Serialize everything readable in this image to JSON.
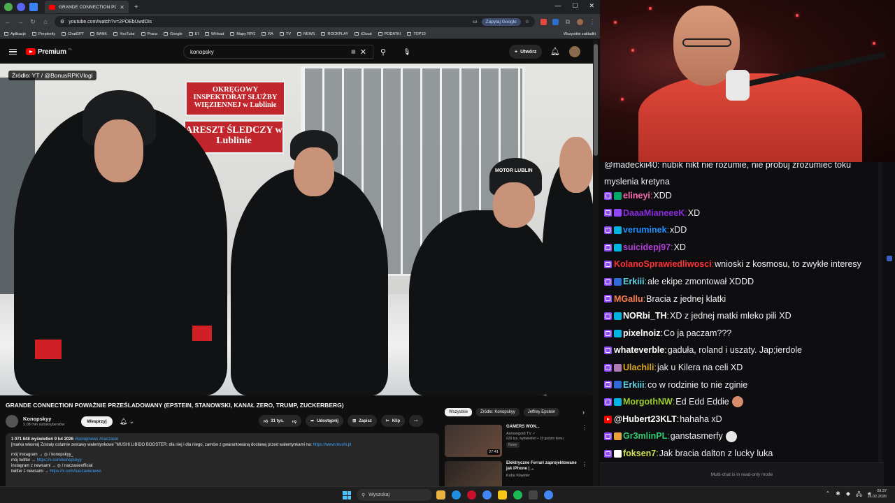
{
  "browser": {
    "tab_title": "GRANDE CONNECTION POWA",
    "url": "youtube.com/watch?v=2POEbUwdOis",
    "ask_google": "Zapytaj Google",
    "bookmarks": [
      "Aplikacje",
      "Perplexity",
      "ChatGPT",
      "BANK",
      "YouTube",
      "Praca",
      "Google",
      "EI",
      "WHead",
      "Mapy RPG",
      "RA",
      "TV",
      "NEWS",
      "ROCKPLAY",
      "iCloud",
      "PODATKI",
      "TOP10"
    ],
    "all_bookmarks": "Wszystkie zakładki"
  },
  "youtube": {
    "logo_text": "Premium",
    "logo_region": "PL",
    "search_value": "konopsky",
    "create_label": "Utwórz",
    "video_source_badge": "Źródło: YT / @BonusRPKVlogi",
    "sign1": "OKRĘGOWY INSPEKTORAT SŁUŻBY WIĘZIENNEJ w Lublinie",
    "sign2": "ARESZT ŚLEDCZY w Lublinie",
    "hat_text": "MOTOR LUBLIN",
    "video_title": "GRANDE CONNECTION POWAŻNIE PRZEŚLADOWANY (EPSTEIN, STANOWSKI, KANAŁ ZERO, TRUMP, ZUCKERBERG)",
    "channel_name": "Konopskyy",
    "channel_subs": "2,08 mln subskrybentów",
    "support_label": "Wesprzyj",
    "likes": "31 tys.",
    "share_label": "Udostępnij",
    "save_label": "Zapisz",
    "clip_label": "Klip",
    "desc_meta": "1 071 848 wyświetleń  9 lut 2026",
    "desc_tags": "#konopnews #naczasie",
    "desc_line1": "[marka własna] Zostały ostatnie zestawy walentynkowe \"MUSHI LIBIDO BOOSTER: dla niej i dla niego, zamów z gwarantowaną dostawą przed walentynkami na:",
    "desc_link1": "https://www.mushi.pl",
    "desc_line2": "mój instagram → ◎ / konopskyy_",
    "desc_line3_a": "mój twitter →",
    "desc_line3_b": "https://x.com/konopskyy",
    "desc_line4": "instagram z newsami → ◎ / naczasieofficial",
    "desc_line5_a": "twitter z newsami →",
    "desc_line5_b": "https://x.com/naczasienews",
    "chips": [
      "Wszystkie",
      "Źródło: Konopskyy",
      "Jeffrey Epstein"
    ],
    "recs": [
      {
        "title": "GAMERS WON...",
        "channel": "Asmongold TV ✓",
        "meta": "629 tys. wyświetleń • 19 godzin temu",
        "badge": "Nowy",
        "duration": "27:41"
      },
      {
        "title": "Elektryczne Ferrari zaprojektowane jak iPhone | ...",
        "channel": "Kuba Klawiter",
        "meta": "",
        "badge": "",
        "duration": ""
      }
    ]
  },
  "chat": {
    "overflow_text": "@madeckii40: nubik nikt nie rozumie, nie probuj zrozumiec toku myslenia kretyna",
    "messages": [
      {
        "platform": "tw",
        "user": "elineyi",
        "color": "#ff69b4",
        "badge_color": "#00a86b",
        "text": "XDD"
      },
      {
        "platform": "tw",
        "user": "DaaaMianeeeK",
        "color": "#8a2be2",
        "badge_color": "#9147ff",
        "text": "XD"
      },
      {
        "platform": "tw",
        "user": "veruminek",
        "color": "#1e90ff",
        "badge_color": "#00b5e2",
        "text": "xDD"
      },
      {
        "platform": "tw",
        "user": "suicidepj97",
        "color": "#b33fd8",
        "badge_color": "#00b5e2",
        "text": "XD"
      },
      {
        "platform": "tw",
        "user": "KolanoSprawiedliwosci",
        "color": "#ff3333",
        "badge_color": "",
        "text": "wnioski z kosmosu, to zwykłe interesy"
      },
      {
        "platform": "tw",
        "user": "Erkiii",
        "color": "#5fd3e8",
        "badge_color": "#2e6bd6",
        "text": "ale ekipe zmontował XDDD"
      },
      {
        "platform": "tw",
        "user": "MGallu",
        "color": "#ff7f50",
        "badge_color": "",
        "text": "Bracia z jednej klatki"
      },
      {
        "platform": "tw",
        "user": "NORbi_TH",
        "color": "#ffffff",
        "badge_color": "#00b5e2",
        "text": "XD z jednej matki mleko pili XD"
      },
      {
        "platform": "tw",
        "user": "pixelnoiz",
        "color": "#ffffff",
        "badge_color": "#00b5e2",
        "text": "Co ja paczam???"
      },
      {
        "platform": "tw",
        "user": "whateverble",
        "color": "#ffffff",
        "badge_color": "",
        "text": "gaduła, roland i uszaty. Jap;ierdole"
      },
      {
        "platform": "tw",
        "user": "Ulachili",
        "color": "#daa520",
        "badge_color": "#b07ab5",
        "text": "jak u Kilera na celi XD"
      },
      {
        "platform": "tw",
        "user": "Erkiii",
        "color": "#5fd3e8",
        "badge_color": "#2e6bd6",
        "text": "co w rodzinie to nie zginie"
      },
      {
        "platform": "tw",
        "user": "MorgothNW",
        "color": "#9acd32",
        "badge_color": "#00b5e2",
        "text": "Ed Edd Eddie"
      },
      {
        "platform": "yt",
        "user": "@Hubert23KLT",
        "color": "#ffffff",
        "badge_color": "",
        "text": "hahaha xD"
      },
      {
        "platform": "tw",
        "user": "Gr3mlinPL",
        "color": "#2ecc71",
        "badge_color": "#e8a33d",
        "text": "ganstasmerfy"
      },
      {
        "platform": "tw",
        "user": "foksen7",
        "color": "#d4e157",
        "badge_color": "#ffffff",
        "text": "Jak bracia dalton z lucky luka"
      }
    ],
    "footer": "Multi-chat is in read-only mode"
  },
  "taskbar": {
    "search_placeholder": "Wyszukaj",
    "time": "09:37",
    "date": "16.02.2026"
  }
}
